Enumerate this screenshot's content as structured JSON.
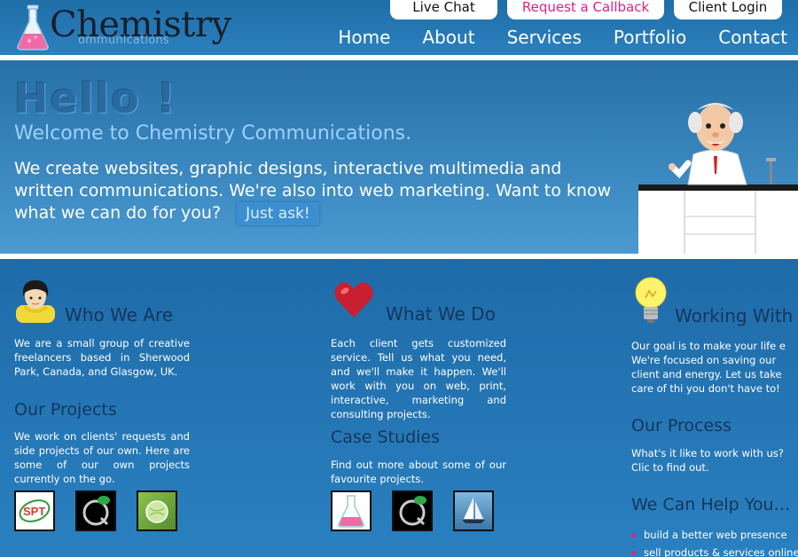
{
  "header": {
    "logo_word": "Chemistry",
    "logo_sub": "ommunications",
    "top_buttons": {
      "live_chat": "Live Chat",
      "request_callback": "Request a Callback",
      "client_login": "Client Login"
    },
    "nav": [
      "Home",
      "About",
      "Services",
      "Portfolio",
      "Contact"
    ]
  },
  "hero": {
    "hello": "Hello !",
    "welcome": "Welcome to Chemistry Communications.",
    "intro": "We create websites, graphic designs, interactive multimedia and written communications. We're also into web marketing. Want to know what we can do for you?",
    "cta": "Just ask!"
  },
  "columns": {
    "who": {
      "title": "Who We Are",
      "text": "We are a small group of creative freelancers based in Sherwood Park, Canada, and Glasgow, UK.",
      "icon": "person-icon"
    },
    "projects": {
      "title": "Our Projects",
      "text": "We work on clients' requests and side projects of our own. Here are some of our own projects currently on the go.",
      "thumb_label": "SPT"
    },
    "what": {
      "title": "What We Do",
      "text": "Each client gets customized service. Tell us what you need, and we'll make it happen. We'll work with you on web, print, interactive, marketing and consulting projects.",
      "icon": "heart-icon"
    },
    "cases": {
      "title": "Case Studies",
      "text": "Find out more about some of our favourite projects."
    },
    "working": {
      "title": "Working With",
      "text": "Our goal is to make your life e We're focused on saving our client and energy. Let us take care of thi you don't have to!",
      "icon": "lightbulb-icon"
    },
    "process": {
      "title": "Our Process",
      "text": "What's it like to work with us? Clic to find out."
    },
    "help": {
      "title": "We Can Help You…",
      "items": [
        "build a better web presence",
        "sell products & services online"
      ]
    }
  },
  "colors": {
    "accent_pink": "#e0208a",
    "heading_navy": "#16365c",
    "background_blue": "#2a7bb6"
  }
}
